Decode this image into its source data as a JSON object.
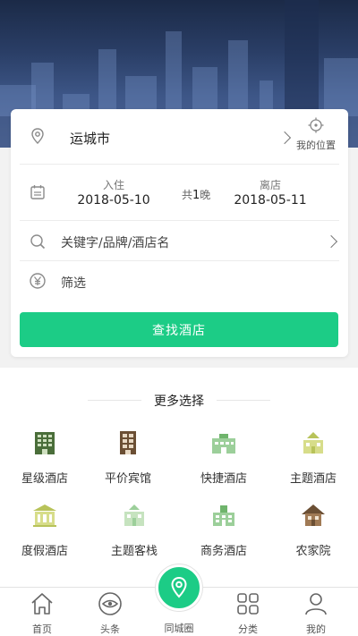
{
  "search": {
    "city": "运城市",
    "my_location_label": "我的位置",
    "checkin_label": "入住",
    "checkin_date": "2018-05-10",
    "nights_prefix": "共",
    "nights_count": "1",
    "nights_suffix": "晚",
    "checkout_label": "离店",
    "checkout_date": "2018-05-11",
    "keyword_placeholder": "关键字/品牌/酒店名",
    "filter_label": "筛选",
    "search_button": "查找酒店"
  },
  "more": {
    "title": "更多选择",
    "categories": [
      {
        "label": "星级酒店",
        "icon": "star-hotel-icon"
      },
      {
        "label": "平价宾馆",
        "icon": "budget-hotel-icon"
      },
      {
        "label": "快捷酒店",
        "icon": "express-hotel-icon"
      },
      {
        "label": "主题酒店",
        "icon": "theme-hotel-icon"
      },
      {
        "label": "度假酒店",
        "icon": "resort-hotel-icon"
      },
      {
        "label": "主题客栈",
        "icon": "theme-inn-icon"
      },
      {
        "label": "商务酒店",
        "icon": "business-hotel-icon"
      },
      {
        "label": "农家院",
        "icon": "farmhouse-icon"
      }
    ]
  },
  "tabbar": {
    "tabs": [
      {
        "label": "首页",
        "icon": "home-icon"
      },
      {
        "label": "头条",
        "icon": "eye-icon"
      },
      {
        "label": "同城圈",
        "icon": "location-pin-icon"
      },
      {
        "label": "分类",
        "icon": "grid-icon"
      },
      {
        "label": "我的",
        "icon": "user-icon"
      }
    ]
  },
  "colors": {
    "accent": "#1ccc86",
    "icon_olive": "#b8c35a",
    "icon_dark_green": "#4a6e3a",
    "icon_brown": "#6b4f34"
  }
}
